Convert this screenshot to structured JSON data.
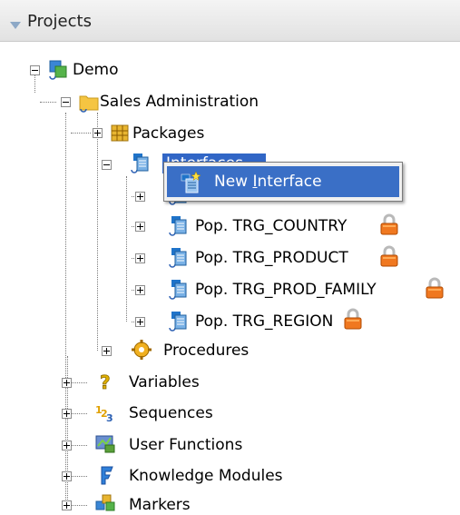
{
  "panel": {
    "title": "Projects"
  },
  "tree": {
    "demo": "Demo",
    "sales_admin": "Sales Administration",
    "packages": "Packages",
    "interfaces": "Interfaces",
    "items": [
      "Pop. TRG_COUNTRY",
      "Pop. TRG_PRODUCT",
      "Pop. TRG_PROD_FAMILY",
      "Pop. TRG_REGION"
    ],
    "procedures": "Procedures",
    "variables": "Variables",
    "sequences": "Sequences",
    "user_functions": "User Functions",
    "knowledge_modules": "Knowledge Modules",
    "markers": "Markers"
  },
  "context_menu": {
    "new_interface_prefix": "New ",
    "new_interface_accel": "I",
    "new_interface_suffix": "nterface"
  },
  "icons": [
    "project-icon",
    "folder-icon",
    "packages-icon",
    "interface-icon",
    "lock-icon",
    "procedures-icon",
    "variables-icon",
    "sequences-icon",
    "user-functions-icon",
    "knowledge-modules-icon",
    "markers-icon",
    "new-interface-icon"
  ],
  "colors": {
    "selection": "#3166c6",
    "lock": "#f07820"
  }
}
